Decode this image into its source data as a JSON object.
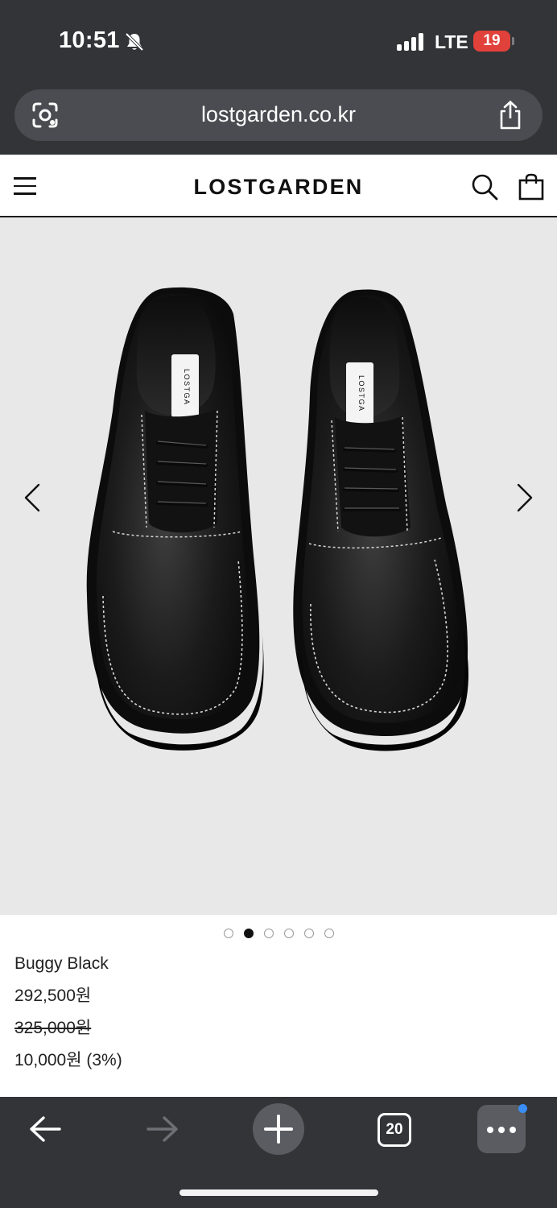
{
  "status_bar": {
    "time": "10:51",
    "network": "LTE",
    "battery": "19",
    "icons": [
      "bell-slash-icon",
      "signal-icon",
      "battery-icon"
    ]
  },
  "browser": {
    "url": "lostgarden.co.kr",
    "tab_count": "20",
    "icons": [
      "lens-icon",
      "share-icon",
      "back-arrow-icon",
      "forward-arrow-icon",
      "plus-icon",
      "tabs-icon",
      "more-dots-icon"
    ]
  },
  "header": {
    "logo": "LOSTGARDEN",
    "icons": [
      "hamburger-menu-icon",
      "search-icon",
      "shopping-bag-icon"
    ]
  },
  "gallery": {
    "image_label": "LOSTGA",
    "slide_count": 6,
    "active_slide": 2,
    "icons": [
      "chevron-left-icon",
      "chevron-right-icon"
    ]
  },
  "product": {
    "name": "Buggy Black",
    "price": "292,500원",
    "original_price": "325,000원",
    "discount": "10,000원 (3%)"
  },
  "colors": {
    "chrome": "#323438",
    "url_pill": "#4a4c51",
    "battery_low": "#e0413a",
    "gallery_bg": "#e8e8e8",
    "notify_badge": "#3a8df5"
  }
}
